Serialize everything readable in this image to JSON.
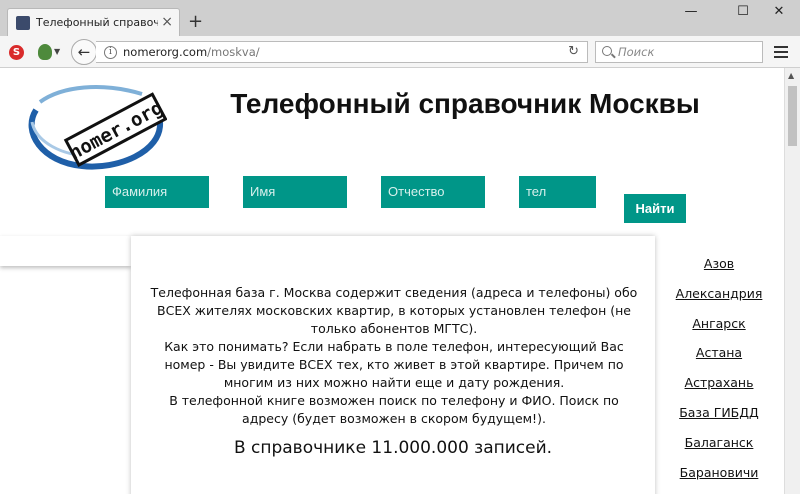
{
  "browser": {
    "tab_title": "Телефонный справочни...",
    "tab_close": "×",
    "new_tab": "+",
    "window_controls": {
      "minimize": "—",
      "maximize": "☐",
      "close": "✕"
    },
    "url_domain": "nomerorg.com",
    "url_path": "/moskva/",
    "search_placeholder": "Поиск",
    "icons": [
      "info-icon",
      "reload-icon",
      "search-icon",
      "menu-icon",
      "back-arrow-icon"
    ]
  },
  "page": {
    "logo_text": "nomer.org",
    "title": "Телефонный справочник Москвы",
    "form": {
      "surname_placeholder": "Фамилия",
      "name_placeholder": "Имя",
      "patronymic_placeholder": "Отчество",
      "phone_placeholder": "тел",
      "submit_label": "Найти"
    },
    "description": [
      "Телефонная база г. Москва содержит сведения (адреса и телефоны) обо ВСЕХ жителях московских квартир, в которых установлен телефон (не только абонентов МГТС).",
      "Как это понимать? Если набрать в поле телефон, интересующий Вас номер - Вы увидите ВСЕХ тех, кто живет в этой квартире. Причем по многим из них можно найти еще и дату рождения.",
      "В телефонной книге возможен поиск по телефону и ФИО. Поиск по адресу (будет возможен в скором будущем!)."
    ],
    "records_text": "В справочнике 11.000.000 записей.",
    "cities": [
      "Азов",
      "Александрия",
      "Ангарск",
      "Астана",
      "Астрахань",
      "База ГИБДД",
      "Балаганск",
      "Барановичи"
    ]
  },
  "colors": {
    "accent": "#009688",
    "logo_blue": "#1f5fa8"
  }
}
